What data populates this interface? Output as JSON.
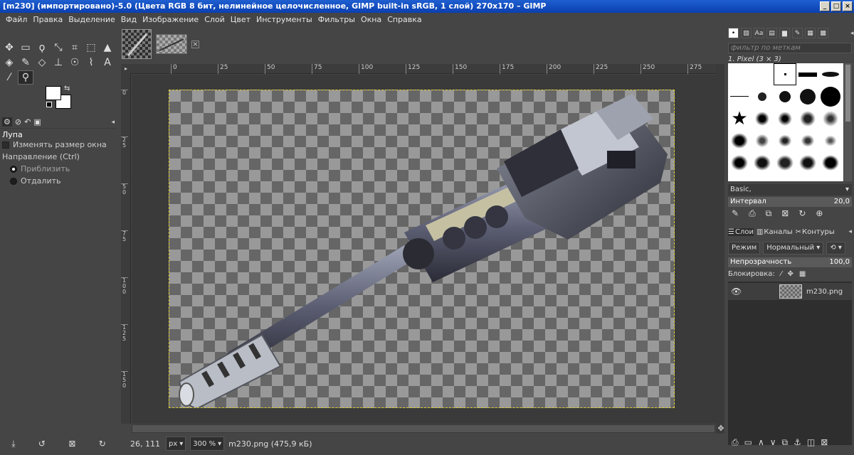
{
  "window": {
    "title": "[m230] (импортировано)-5.0 (Цвета RGB 8 бит, нелинейное целочисленное, GIMP built-in sRGB, 1 слой) 270x170 – GIMP"
  },
  "menu": [
    "Файл",
    "Правка",
    "Выделение",
    "Вид",
    "Изображение",
    "Слой",
    "Цвет",
    "Инструменты",
    "Фильтры",
    "Окна",
    "Справка"
  ],
  "tool_options": {
    "title": "Лупа",
    "resize_window": "Изменять размер окна",
    "direction_label": "Направление  (Ctrl)",
    "zoom_in": "Приблизить",
    "zoom_out": "Отдалить"
  },
  "rulers": {
    "h": [
      "0",
      "25",
      "50",
      "75",
      "100",
      "125",
      "150",
      "175",
      "200",
      "225",
      "250",
      "275"
    ],
    "v": [
      "0",
      "25",
      "50",
      "75",
      "100",
      "125",
      "150"
    ]
  },
  "status": {
    "coords": "26, 111",
    "unit": "px",
    "zoom": "300 %",
    "info": "m230.png (475,9 кБ)"
  },
  "brushes": {
    "filter_placeholder": "фильтр по меткам",
    "current": "1. Pixel (3 × 3)",
    "set": "Basic,",
    "interval_label": "Интервал",
    "interval_value": "20,0"
  },
  "layers": {
    "tabs": [
      "Слои",
      "Каналы",
      "Контуры"
    ],
    "mode_label": "Режим",
    "mode_value": "Нормальный",
    "opacity_label": "Непрозрачность",
    "opacity_value": "100,0",
    "lock_label": "Блокировка:",
    "items": [
      {
        "name": "m230.png",
        "visible": true
      }
    ]
  }
}
